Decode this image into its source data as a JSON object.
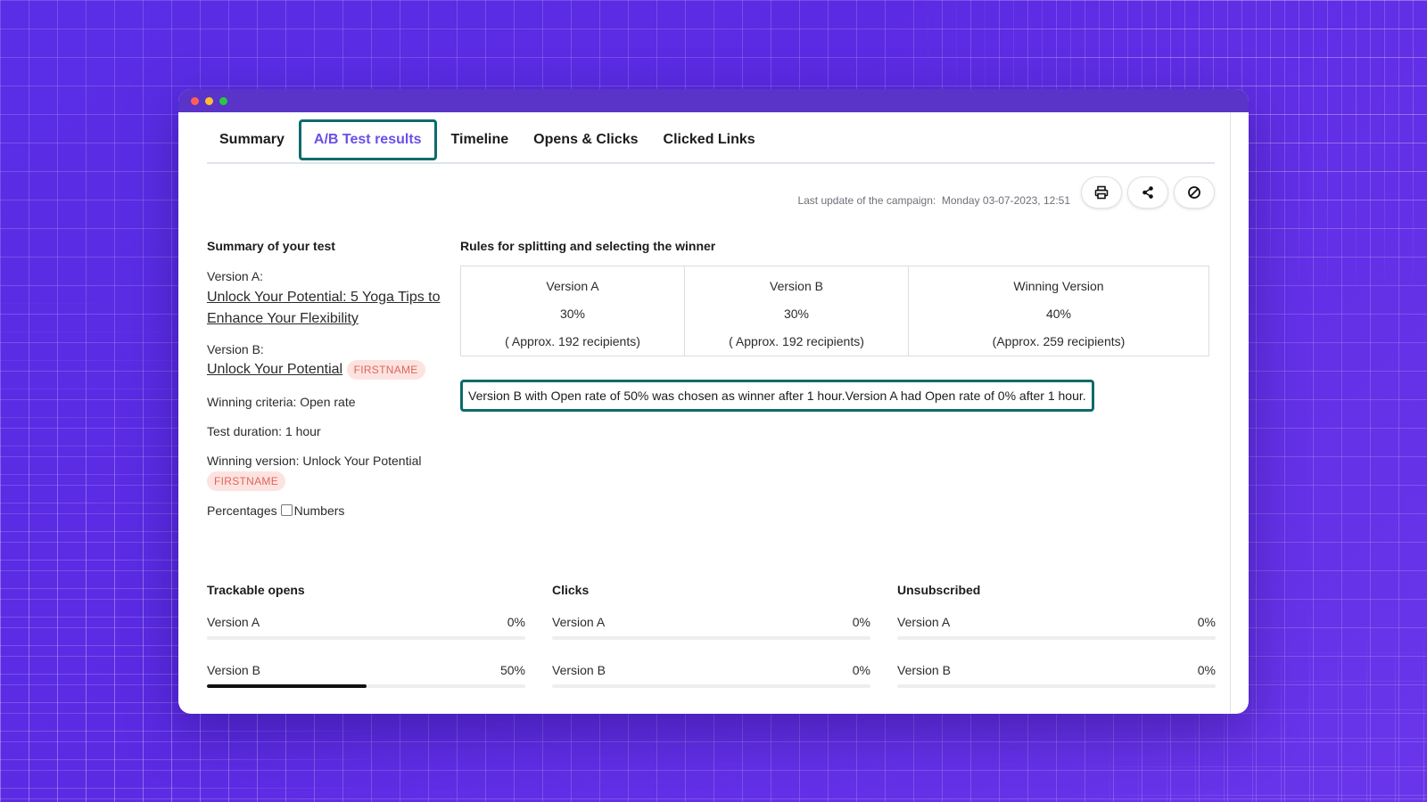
{
  "tabs": [
    {
      "label": "Summary",
      "active": false
    },
    {
      "label": "A/B Test results",
      "active": true
    },
    {
      "label": "Timeline",
      "active": false
    },
    {
      "label": "Opens & Clicks",
      "active": false
    },
    {
      "label": "Clicked Links",
      "active": false
    }
  ],
  "header": {
    "last_update_label": "Last update of the campaign:",
    "last_update_value": "Monday 03-07-2023, 12:51",
    "buttons": [
      {
        "icon": "printer-icon"
      },
      {
        "icon": "share-icon"
      },
      {
        "icon": "cancel-icon"
      }
    ]
  },
  "summary": {
    "title": "Summary of your test",
    "version_a_label": "Version A:",
    "version_a_subject": "Unlock Your Potential: 5 Yoga Tips to Enhance Your Flexibility",
    "version_b_label": "Version B:",
    "version_b_subject": "Unlock Your Potential",
    "version_b_tag": "FIRSTNAME",
    "winning_criteria": "Winning criteria: Open rate",
    "test_duration": "Test duration: 1 hour",
    "winning_version": "Winning version: Unlock Your Potential",
    "winning_tag": "FIRSTNAME",
    "toggle_left": "Percentages",
    "toggle_right": "Numbers"
  },
  "rules": {
    "title": "Rules for splitting and selecting the winner",
    "columns": [
      {
        "name": "Version A",
        "percent": "30%",
        "recipients": "( Approx. 192 recipients)"
      },
      {
        "name": "Version B",
        "percent": "30%",
        "recipients": "( Approx. 192 recipients)"
      },
      {
        "name": "Winning Version",
        "percent": "40%",
        "recipients": "(Approx. 259 recipients)"
      }
    ],
    "winner_note": "Version B with Open rate of 50% was chosen as winner after 1 hour.Version A had Open rate of 0% after 1 hour."
  },
  "stats": [
    {
      "title": "Trackable opens",
      "rows": [
        {
          "label": "Version A",
          "value": "0%",
          "fill": 0
        },
        {
          "label": "Version B",
          "value": "50%",
          "fill": 0.5
        }
      ]
    },
    {
      "title": "Clicks",
      "rows": [
        {
          "label": "Version A",
          "value": "0%",
          "fill": 0
        },
        {
          "label": "Version B",
          "value": "0%",
          "fill": 0
        }
      ]
    },
    {
      "title": "Unsubscribed",
      "rows": [
        {
          "label": "Version A",
          "value": "0%",
          "fill": 0
        },
        {
          "label": "Version B",
          "value": "0%",
          "fill": 0
        }
      ]
    }
  ],
  "colors": {
    "accent": "#6b4fe8",
    "highlight_border": "#0d6b6b",
    "tag_text": "#e0645a",
    "tag_bg": "#fde3e0"
  }
}
